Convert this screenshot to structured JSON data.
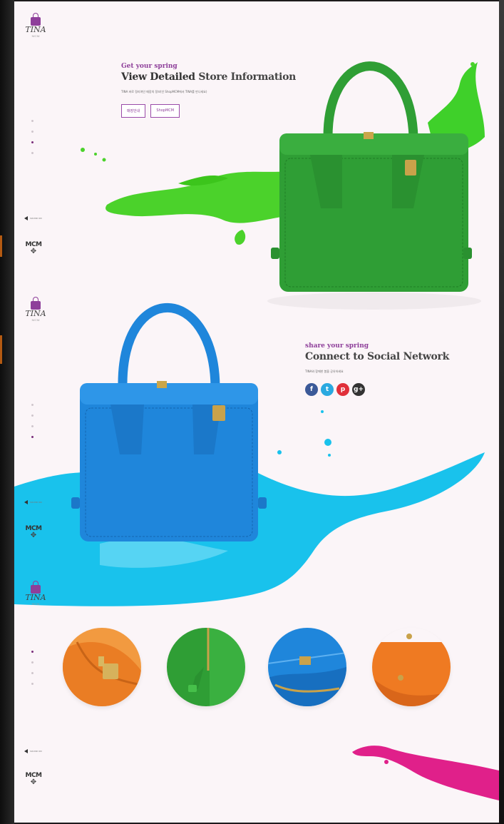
{
  "hero_store": {
    "eyebrow": "Get your spring",
    "headline_bold": "View Detailed",
    "headline_rest": " Store Information",
    "body_text": "TINA 바로 정리여인 매장의 정보(인 ShopMCM에서 TINA를 만나세요)",
    "buttons": [
      "매장안내",
      "ShopMCM"
    ]
  },
  "hero_social": {
    "eyebrow": "share your spring",
    "headline": "Connect to Social Network",
    "body_text": "TINA와 함께한 봄을 공유하세요",
    "social_icons": [
      {
        "name": "facebook-icon",
        "glyph": "f",
        "color": "#3b5998"
      },
      {
        "name": "twitter-icon",
        "glyph": "t",
        "color": "#2aa9e0"
      },
      {
        "name": "pinterest-icon",
        "glyph": "p",
        "color": "#e0303a"
      },
      {
        "name": "googleplus-icon",
        "glyph": "g+",
        "color": "#333333"
      }
    ]
  },
  "brand": {
    "logo_word": "TINA",
    "logo_sub": "MCM",
    "footer_mark": "MCM",
    "sound_label": "SOUND ON"
  },
  "page_dots": [
    {
      "active_index": 2,
      "count": 4
    },
    {
      "active_index": 3,
      "count": 4
    },
    {
      "active_index": 0,
      "count": 4
    }
  ],
  "colors": {
    "accent": "#8e3f9a",
    "green_bag": "#2f9e35",
    "blue_bag": "#1f86db",
    "pink_splash": "#e0208a",
    "orange_bag": "#f0802a"
  }
}
